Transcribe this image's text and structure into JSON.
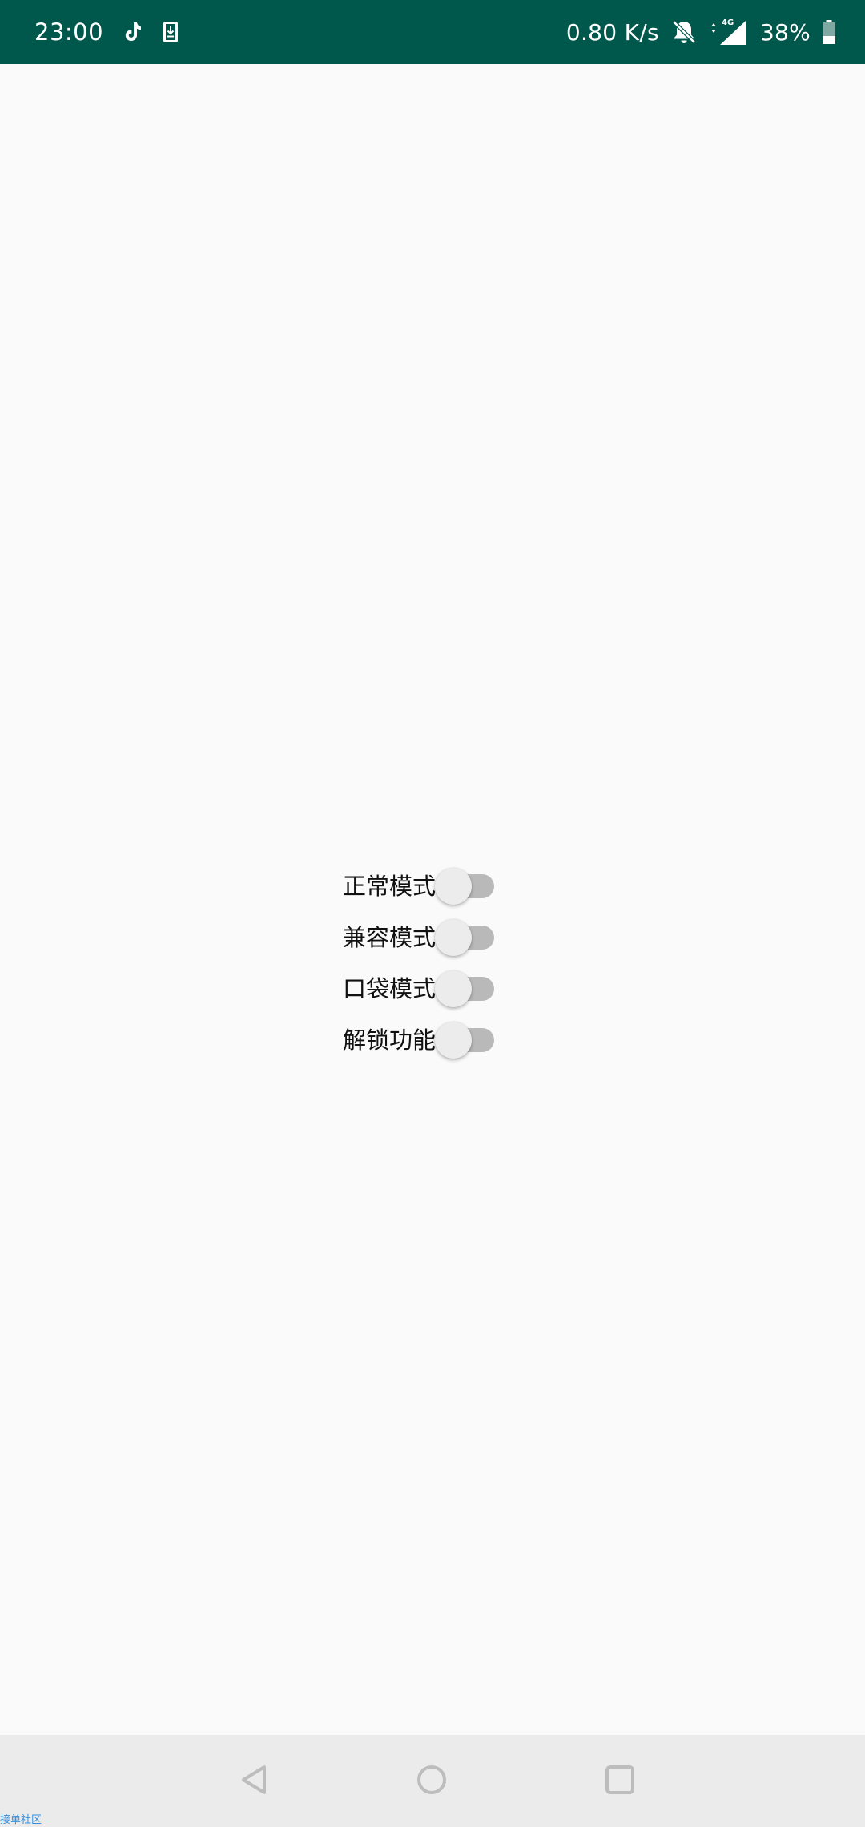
{
  "status_bar": {
    "time": "23:00",
    "net_speed": "0.80 K/s",
    "network_type": "4G",
    "battery_percent": "38%",
    "battery_level": 0.38,
    "icons": [
      "tiktok-icon",
      "download-icon",
      "bell-off-icon",
      "data-arrows-icon",
      "signal-icon",
      "battery-icon"
    ],
    "background_color": "#00584c"
  },
  "main": {
    "options": [
      {
        "label": "正常模式",
        "enabled": false
      },
      {
        "label": "兼容模式",
        "enabled": false
      },
      {
        "label": "口袋模式",
        "enabled": false
      },
      {
        "label": "解锁功能",
        "enabled": false
      }
    ]
  },
  "nav_bar": {
    "icons": [
      "back-icon",
      "home-icon",
      "recents-icon"
    ]
  },
  "watermark": {
    "text": "接单社区"
  }
}
